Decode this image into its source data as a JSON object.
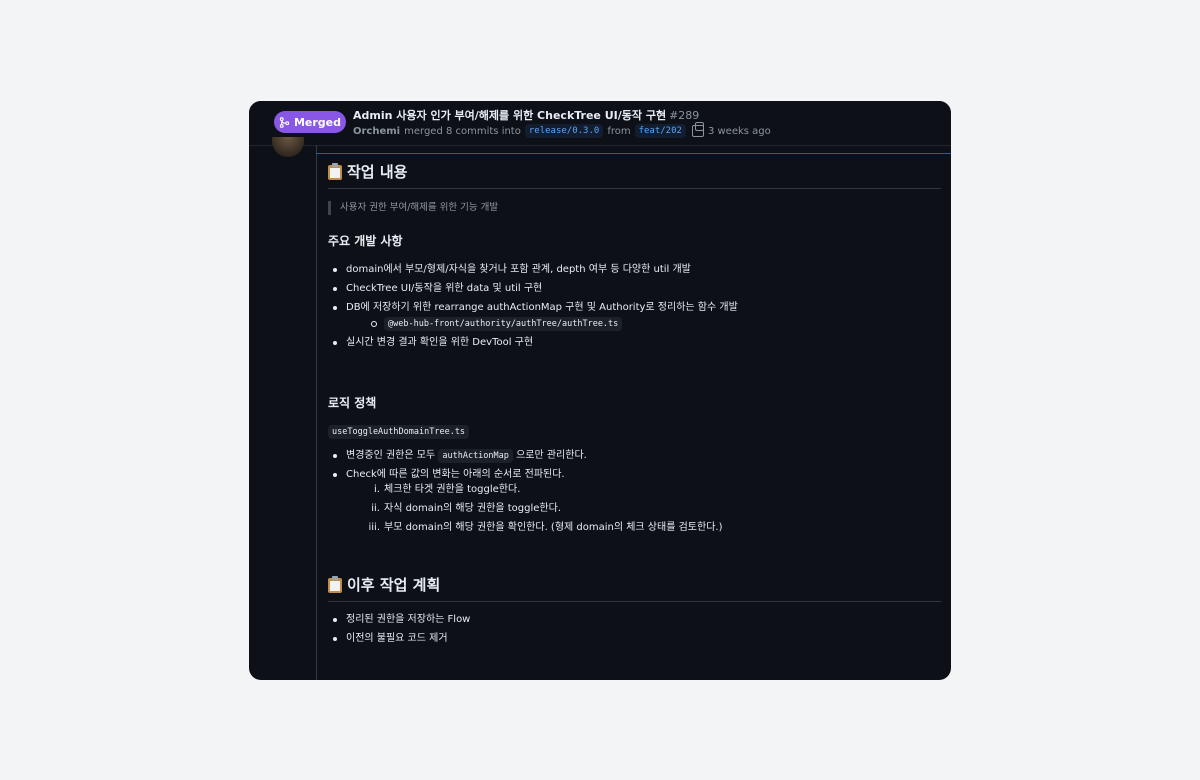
{
  "header": {
    "badge": "Merged",
    "title": "Admin 사용자 인가 부여/해제를 위한 CheckTree UI/동작 구현",
    "number": "#289",
    "author": "Orchemi",
    "merged_text": "merged 8 commits into",
    "base_branch": "release/0.3.0",
    "from_text": "from",
    "head_branch": "feat/202",
    "time": "3 weeks ago"
  },
  "colors": {
    "merged": "#8957e5",
    "bg": "#0d1117",
    "link": "#58a6ff"
  },
  "icons": {
    "badge": "git-merge-icon",
    "copy": "copy-icon",
    "heading": "clipboard-icon"
  },
  "body": {
    "section1_title": "작업 내용",
    "quote": "사용자 권한 부여/해제를 위한 기능 개발",
    "main_dev_title": "주요 개발 사항",
    "main_dev_items": [
      "domain에서 부모/형제/자식을 찾거나 포함 관계, depth 여부 등 다양한 util 개발",
      "CheckTree UI/동작을 위한 data 및 util 구현",
      "DB에 저장하기 위한 rearrange authActionMap 구현 및 Authority로 정리하는 함수 개발",
      "실시간 변경 결과 확인을 위한 DevTool 구현"
    ],
    "sub_item_code": "@web-hub-front/authority/authTree/authTree.ts",
    "logic_title": "로직 정책",
    "logic_file": "useToggleAuthDomainTree.ts",
    "logic_item1_pre": "변경중인 권한은 모두",
    "logic_item1_code": "authActionMap",
    "logic_item1_post": "으로만 관리한다.",
    "logic_item2": "Check에 따른 값의 변화는 아래의 순서로 전파된다.",
    "ordered": [
      {
        "num": "i.",
        "text": "체크한 타겟 권한을 toggle한다."
      },
      {
        "num": "ii.",
        "text": "자식 domain의 해당 권한을 toggle한다."
      },
      {
        "num": "iii.",
        "text": "부모 domain의 해당 권한을 확인한다. (형제 domain의 체크 상태를 검토한다.)"
      }
    ],
    "section2_title": "이후 작업 계획",
    "plan_items": [
      "정리된 권한을 저장하는 Flow",
      "이전의 불필요 코드 제거"
    ]
  }
}
